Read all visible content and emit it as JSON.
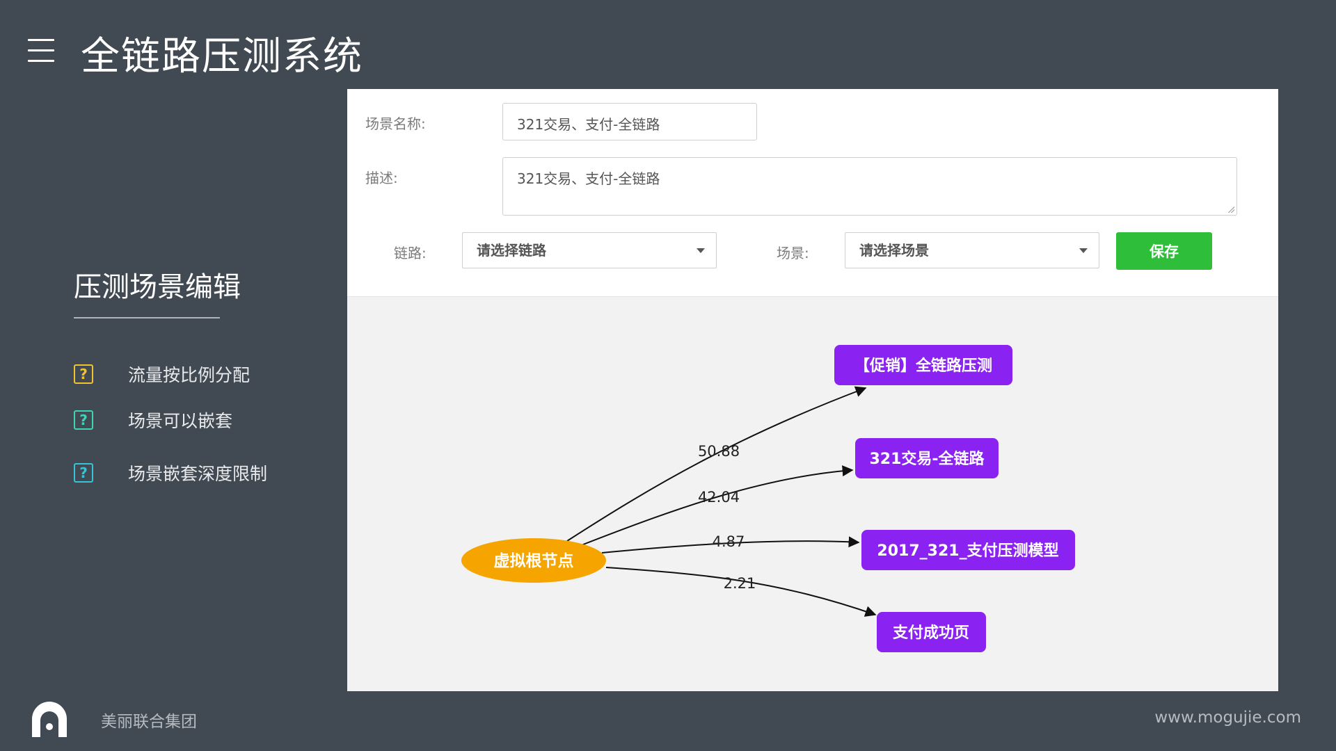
{
  "header": {
    "title": "全链路压测系统",
    "menu_icon": "hamburger-menu-icon"
  },
  "sidebar": {
    "title": "压测场景编辑",
    "features": [
      {
        "label": "流量按比例分配",
        "color": "#f2c230"
      },
      {
        "label": "场景可以嵌套",
        "color": "#3fd4b6"
      },
      {
        "label": "场景嵌套深度限制",
        "color": "#36c4d8"
      }
    ],
    "icon_glyph": "?"
  },
  "form": {
    "scene_name_label": "场景名称:",
    "scene_name_value": "321交易、支付-全链路",
    "description_label": "描述:",
    "description_value": "321交易、支付-全链路",
    "link_label": "链路:",
    "link_select": "请选择链路",
    "scene_label": "场景:",
    "scene_select": "请选择场景",
    "save_label": "保存"
  },
  "graph": {
    "root": "虚拟根节点",
    "edges": [
      {
        "target": "【促销】全链路压测",
        "weight": "50.88"
      },
      {
        "target": "321交易-全链路",
        "weight": "42.04"
      },
      {
        "target": "2017_321_支付压测模型",
        "weight": "4.87"
      },
      {
        "target": "支付成功页",
        "weight": "2.21"
      }
    ],
    "root_color": "#f5a400",
    "node_color": "#8a22f2"
  },
  "footer": {
    "company": "美丽联合集团",
    "url": "www.mogujie.com"
  },
  "colors": {
    "background": "#414a53",
    "save": "#2fbe3a"
  }
}
